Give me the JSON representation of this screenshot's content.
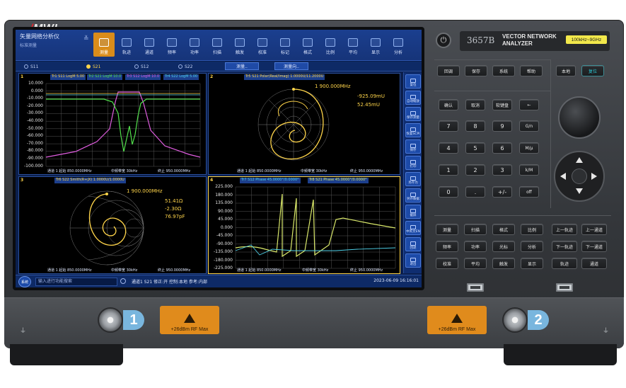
{
  "brand": {
    "logo": "MWI"
  },
  "instrument": {
    "model": "3657B",
    "product_line1": "VECTOR NETWORK",
    "product_line2": "ANALYZER",
    "freq_range": "100kHz~9GHz",
    "port1_label": "1",
    "port2_label": "2",
    "rf_warning": "+26dBm RF Max"
  },
  "app": {
    "title": "矢量网络分析仪",
    "subtitle": "标准测量"
  },
  "menu": [
    {
      "label": "测量",
      "active": true
    },
    {
      "label": "轨迹"
    },
    {
      "label": "通道"
    },
    {
      "label": "频率"
    },
    {
      "label": "功率"
    },
    {
      "label": "扫描"
    },
    {
      "label": "触发"
    },
    {
      "label": "校准"
    },
    {
      "label": "标记"
    },
    {
      "label": "格式"
    },
    {
      "label": "比例"
    },
    {
      "label": "平均"
    },
    {
      "label": "显示"
    },
    {
      "label": "分析"
    }
  ],
  "traces": {
    "tabs": [
      "S11",
      "S21",
      "S12",
      "S22"
    ],
    "selected": "S21",
    "button1": "测量..",
    "button2": "测量向.."
  },
  "panes": {
    "p1": {
      "num": "1",
      "headers": [
        "Tr1 S11 LogM 5.00",
        "Tr2 S21 LogM 10.0",
        "Tr3 S12 LogM 10.0",
        "Tr4 S22 LogM 5.00"
      ],
      "header_colors": [
        "#ffd54a",
        "#52e04c",
        "#e05de0",
        "#4fd1e8"
      ],
      "y_labels": [
        "10.000",
        "0.000",
        "-10.000",
        "-20.000",
        "-30.000",
        "-40.000",
        "-50.000",
        "-60.000",
        "-70.000",
        "-80.000",
        "-90.000",
        "-100.000"
      ],
      "footer_left": "通道 1 起始 850.0000MHz",
      "footer_mid": "中频带宽 30kHz",
      "footer_right": "终止 950.0000MHz"
    },
    "p2": {
      "num": "2",
      "header": "Tr5 S21 Polar(Real/Imag) 1.0000U/11.2000U",
      "marker": "1  900.000MHz",
      "marker_v1": "-925.09mU",
      "marker_v2": "52.45mU",
      "footer_left": "通道 1 起始 850.0000MHz",
      "footer_mid": "中频带宽 30kHz",
      "footer_right": "终止 950.0000MHz"
    },
    "p3": {
      "num": "3",
      "header": "Tr6 S22 Smith(R+jX) 1.0000U/1.0000U",
      "marker": "1  900.000MHz",
      "v1": "51.41Ω",
      "v2": "-2.30Ω",
      "v3": "76.97pF",
      "footer_left": "通道 1 起始 850.0000MHz",
      "footer_mid": "中频带宽 30kHz",
      "footer_right": "终止 950.0000MHz"
    },
    "p4": {
      "num": "4",
      "headers": [
        "Tr7 S12 Phase 45.0000°/0.0000°",
        "Tr8 S21 Phase 45.0000°/0.0000°"
      ],
      "y_labels": [
        "225.000",
        "180.000",
        "135.000",
        "90.000",
        "45.000",
        "0.000",
        "-45.000",
        "-90.000",
        "-135.000",
        "-180.000",
        "-225.000"
      ],
      "footer_left": "通道 1 起始 850.0000MHz",
      "footer_mid": "中频带宽 30kHz",
      "footer_right": "终止 950.0000MHz"
    }
  },
  "softkeys": [
    "复位",
    "自动缩放",
    "保存测量",
    "恢复SCPI",
    "保存",
    "打印",
    "另存为",
    "另存数据",
    "截屏",
    "中英文EN",
    "回退",
    "退出"
  ],
  "status": {
    "sys": "系统",
    "input_placeholder": "输入进行功能搜索",
    "text": "通道1 S21 修正:开 控制:本地 参考:内部",
    "datetime": "2023-06-09 16:16:01"
  },
  "panel": {
    "row_top": [
      "回调",
      "保存",
      "系统",
      "帮助"
    ],
    "local": "本地",
    "preset": "复位",
    "row_entry": [
      "确认",
      "取消",
      "软键盘",
      "←"
    ],
    "numpad": [
      [
        "7",
        "8",
        "9",
        "G/n"
      ],
      [
        "4",
        "5",
        "6",
        "M/μ"
      ],
      [
        "1",
        "2",
        "3",
        "k/M"
      ],
      [
        "0",
        ".",
        "+/-",
        "off"
      ]
    ],
    "func_row1": [
      "测量",
      "扫描",
      "格式",
      "比例"
    ],
    "func_row2": [
      "频率",
      "功率",
      "光标",
      "分析"
    ],
    "func_row3": [
      "校准",
      "平均",
      "触发",
      "显示"
    ],
    "nav_col1": [
      "上一轨迹",
      "下一轨迹",
      "轨迹"
    ],
    "nav_col2": [
      "上一通道",
      "下一通道",
      "通道"
    ]
  }
}
